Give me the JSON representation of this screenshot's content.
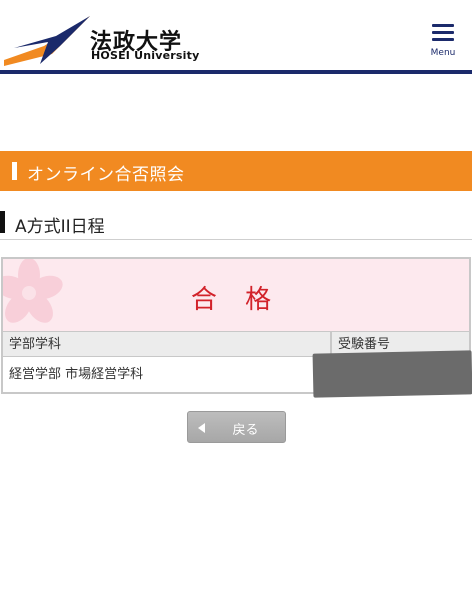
{
  "header": {
    "logo_jp": "法政大学",
    "logo_en": "HOSEI University",
    "menu_label": "Menu",
    "brand_color": "#1b2a6b",
    "logo_accent": "#f18a21"
  },
  "banner": {
    "title": "オンライン合否照会",
    "color": "#f18a21"
  },
  "section": {
    "title": "A方式II日程"
  },
  "result": {
    "status": "合 格",
    "columns": [
      "学部学科",
      "受験番号"
    ],
    "rows": [
      {
        "department": "経営学部 市場経営学科",
        "exam_number": ""
      }
    ]
  },
  "back_button": {
    "label": "戻る"
  }
}
